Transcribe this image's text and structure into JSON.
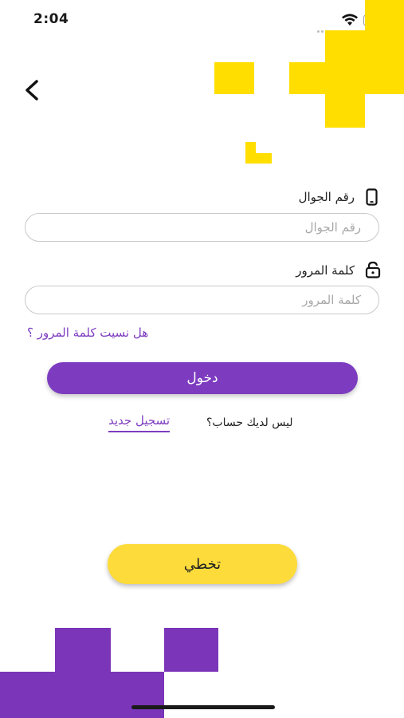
{
  "status_bar": {
    "time": "2:04"
  },
  "colors": {
    "brand_purple": "#7d3cc0",
    "brand_yellow": "#ffde00",
    "skip_yellow": "#fddb3a"
  },
  "form": {
    "phone_label": "رقم الجوال",
    "phone_placeholder": "رقم الجوال",
    "password_label": "كلمة المرور",
    "password_placeholder": "كلمة المرور",
    "forgot_password": "هل نسيت كلمة المرور ؟",
    "login_button": "دخول",
    "no_account_text": "ليس لديك حساب؟",
    "register_link": "تسجيل جديد"
  },
  "skip_button": "تخطي",
  "icons": {
    "back": "chevron-left-icon",
    "phone": "phone-icon",
    "lock": "lock-icon"
  }
}
